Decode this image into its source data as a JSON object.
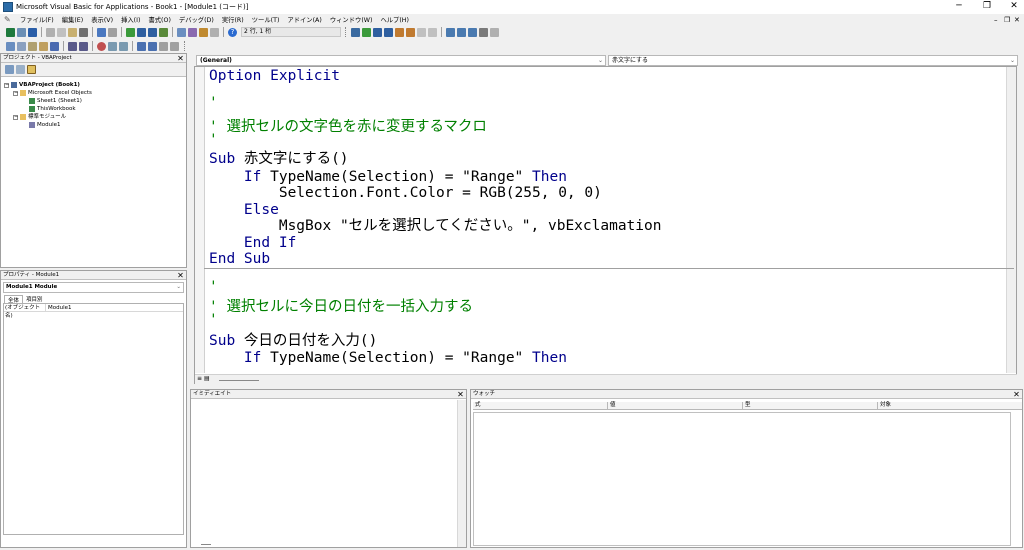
{
  "window": {
    "title": "Microsoft Visual Basic for Applications - Book1 - [Module1 (コード)]",
    "min_glyph": "─",
    "restore_glyph": "❐",
    "close_glyph": "✕"
  },
  "menu": [
    "ファイル(F)",
    "編集(E)",
    "表示(V)",
    "挿入(I)",
    "書式(O)",
    "デバッグ(D)",
    "実行(R)",
    "ツール(T)",
    "アドイン(A)",
    "ウィンドウ(W)",
    "ヘルプ(H)"
  ],
  "toolbar": {
    "position": "2 行, 1 桁",
    "help_glyph": "?"
  },
  "project": {
    "title": "プロジェクト - VBAProject",
    "root": "VBAProject (Book1)",
    "excel_objects": "Microsoft Excel Objects",
    "sheet1": "Sheet1 (Sheet1)",
    "thisworkbook": "ThisWorkbook",
    "modules_folder": "標準モジュール",
    "module1": "Module1"
  },
  "properties": {
    "title": "プロパティ - Module1",
    "object": "Module1  Module",
    "tab_all": "全体",
    "tab_category": "項目別",
    "prop_name": "(オブジェクト名)",
    "prop_value": "Module1"
  },
  "code": {
    "object_combo": "(General)",
    "procedure_combo": "赤文字にする",
    "lines": {
      "l1": "Option Explicit",
      "l2": "'",
      "l3": "' 選択セルの文字色を赤に変更するマクロ",
      "l4": "'",
      "l5a": "Sub",
      "l5b": " 赤文字にする()",
      "l6a": "    If",
      "l6b": " TypeName(Selection) = \"Range\" ",
      "l6c": "Then",
      "l7": "        Selection.Font.Color = RGB(255, 0, 0)",
      "l8": "    Else",
      "l9": "        MsgBox \"セルを選択してください。\", vbExclamation",
      "l10": "    End If",
      "l11": "End Sub",
      "l12": "'",
      "l13": "' 選択セルに今日の日付を一括入力する",
      "l14": "'",
      "l15a": "Sub",
      "l15b": " 今日の日付を入力()",
      "l16a": "    If",
      "l16b": " TypeName(Selection) = \"Range\" ",
      "l16c": "Then"
    }
  },
  "immediate": {
    "title": "イミディエイト"
  },
  "watch": {
    "title": "ウォッチ",
    "col_expr": "式",
    "col_value": "値",
    "col_type": "型",
    "col_target": "対象"
  },
  "colors": {
    "keyword": "#00008b",
    "comment": "#008000"
  }
}
